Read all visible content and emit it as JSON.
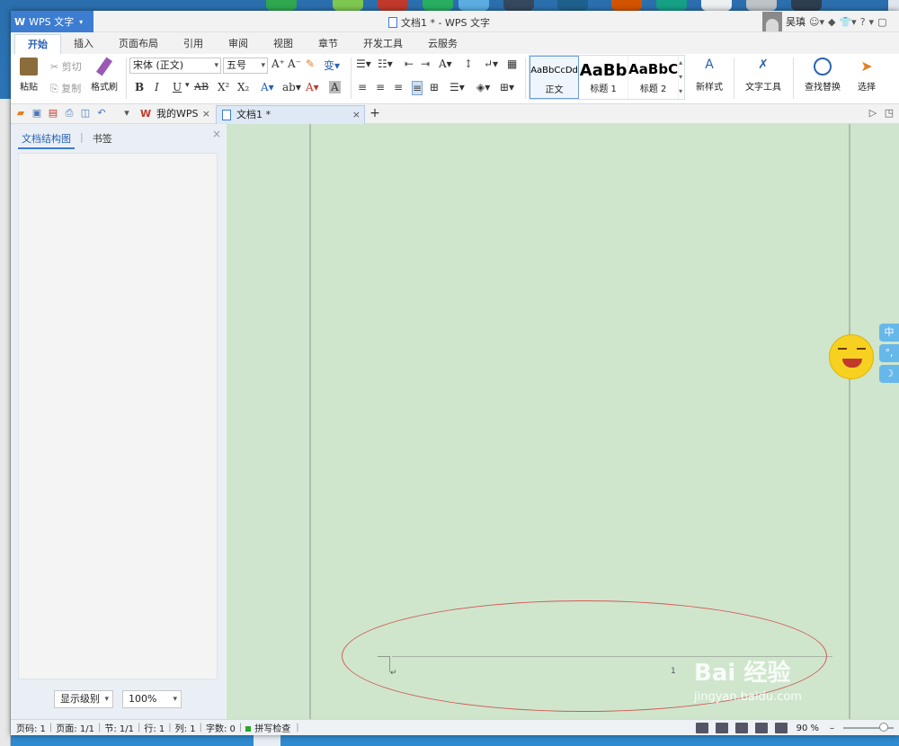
{
  "window": {
    "app_button_label": "WPS 文字",
    "title": "文档1 * - WPS 文字",
    "user_name": "吴瑱",
    "help_label": "?"
  },
  "menu_tabs": [
    "开始",
    "插入",
    "页面布局",
    "引用",
    "审阅",
    "视图",
    "章节",
    "开发工具",
    "云服务"
  ],
  "ribbon": {
    "paste": "粘贴",
    "cut": "剪切",
    "copy": "复制",
    "format_painter": "格式刷",
    "font_name": "宋体 (正文)",
    "font_size": "五号",
    "bold": "B",
    "italic": "I",
    "underline": "U",
    "strikethrough": "AB",
    "superscript": "X²",
    "subscript": "X₂",
    "styles": [
      {
        "preview": "AaBbCcDd",
        "label": "正文"
      },
      {
        "preview": "AaBb",
        "label": "标题 1"
      },
      {
        "preview": "AaBbC",
        "label": "标题 2"
      }
    ],
    "new_style": "新样式",
    "text_tools": "文字工具",
    "find_replace": "查找替换",
    "select": "选择"
  },
  "doc_tabs": {
    "my_wps": "我的WPS",
    "doc1": "文档1 *",
    "close": "×",
    "add": "+"
  },
  "left_panel": {
    "tab_structure": "文档结构图",
    "tab_bookmark": "书签",
    "close": "×",
    "level_select": "显示级别",
    "zoom_select": "100%"
  },
  "document": {
    "page_number_text": "1",
    "paragraph_mark": "↵"
  },
  "side_buttons": [
    "中",
    "°,",
    "☽"
  ],
  "watermark": {
    "text": "Bai 经验",
    "url": "jingyan.baidu.com"
  },
  "status_bar": {
    "page_code": "页码: 1",
    "page": "页面: 1/1",
    "section": "节: 1/1",
    "row": "行: 1",
    "column": "列: 1",
    "words": "字数: 0",
    "spell_check": "拼写检查",
    "zoom": "90 %",
    "zoom_minus": "–"
  },
  "colors": {
    "accent": "#3c7dd2",
    "canvas": "#cfe5cd",
    "annotation": "#d25a55"
  }
}
